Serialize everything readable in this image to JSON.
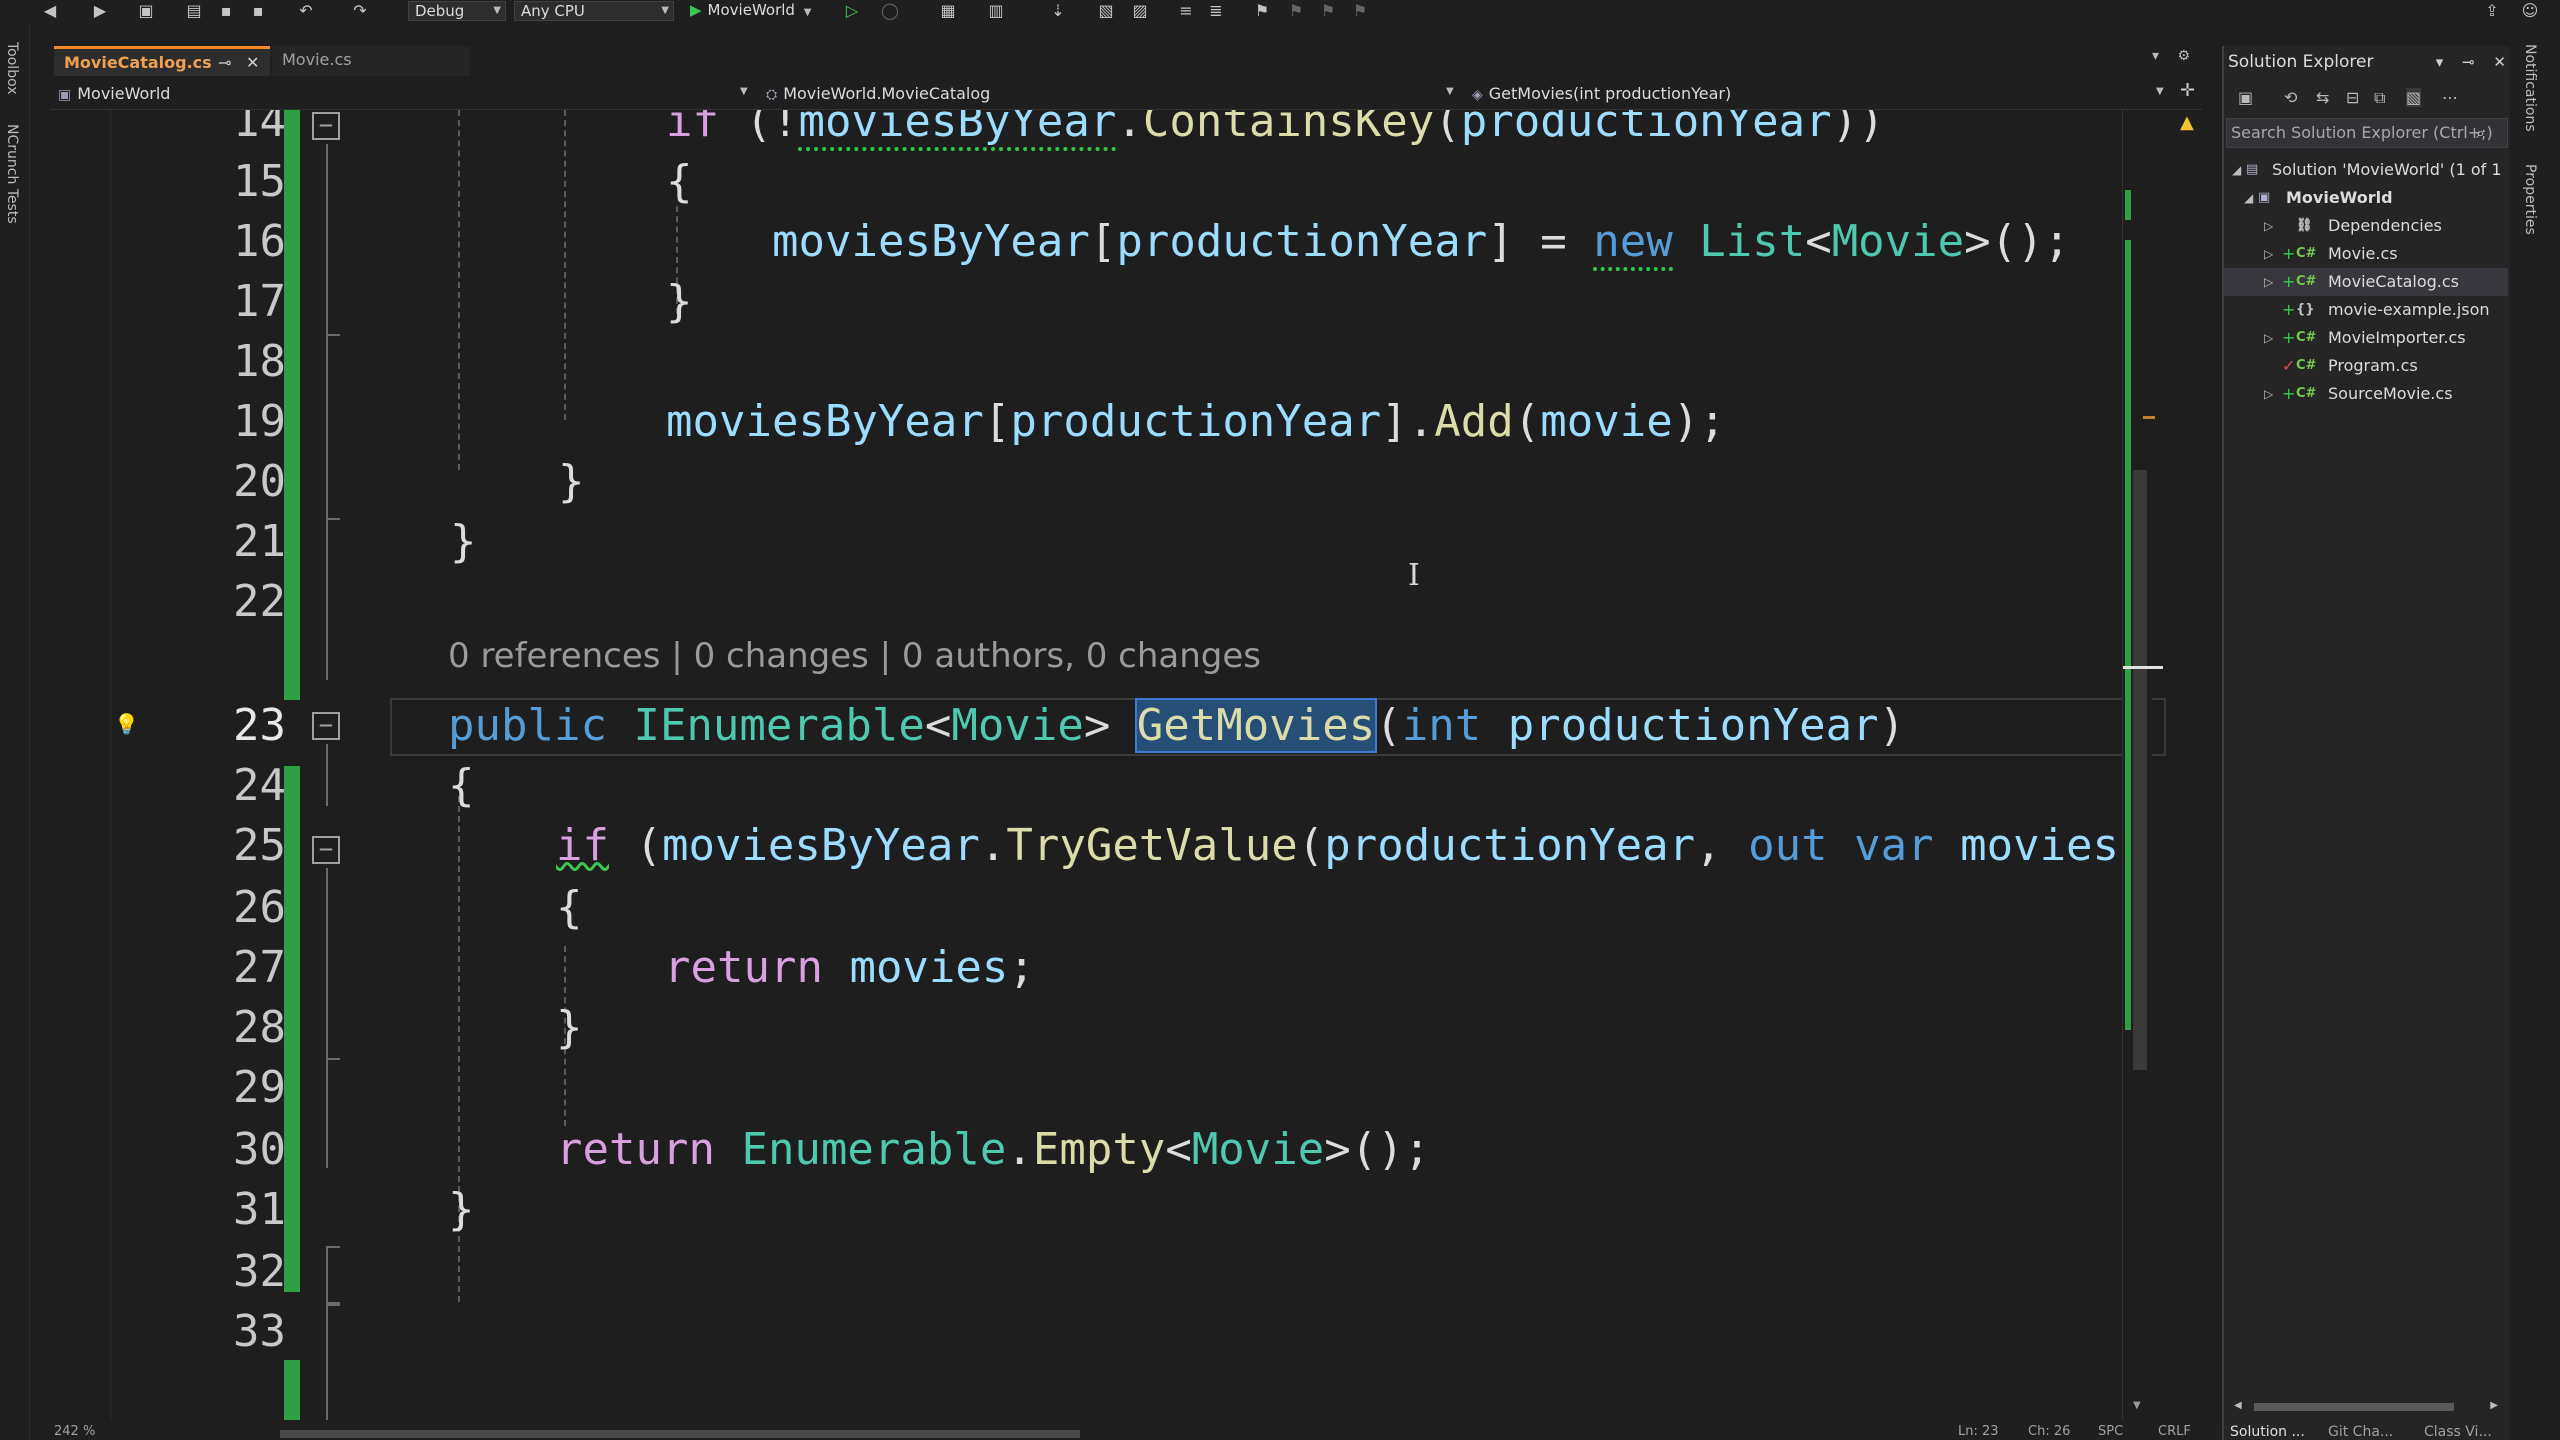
{
  "toolbar": {
    "config": "Debug",
    "platform": "Any CPU",
    "run_target": "MovieWorld"
  },
  "left_rail": {
    "toolbox": "Toolbox",
    "ncrunch": "NCrunch Tests"
  },
  "tabs": [
    {
      "label": "MovieCatalog.cs",
      "active": true
    },
    {
      "label": "Movie.cs",
      "active": false
    }
  ],
  "navbar": {
    "project": "MovieWorld",
    "class": "MovieWorld.MovieCatalog",
    "member": "GetMovies(int productionYear)"
  },
  "editor": {
    "line_numbers": [
      "14",
      "15",
      "16",
      "17",
      "18",
      "19",
      "20",
      "21",
      "22",
      "23",
      "24",
      "25",
      "26",
      "27",
      "28",
      "29",
      "30",
      "31",
      "32",
      "33"
    ],
    "codelens": "0 references | 0 changes | 0 authors, 0 changes",
    "code": {
      "l14": [
        "if",
        " (!",
        "moviesByYear",
        ".",
        "ContainsKey",
        "(",
        "productionYear",
        "))"
      ],
      "l15": "{",
      "l16": [
        "moviesByYear",
        "[",
        "productionYear",
        "] = ",
        "new",
        " ",
        "List",
        "<",
        "Movie",
        ">();"
      ],
      "l17": "}",
      "l19": [
        "moviesByYear",
        "[",
        "productionYear",
        "].",
        "Add",
        "(",
        "movie",
        ");"
      ],
      "l20": "}",
      "l21": "}",
      "l23": [
        "public",
        " ",
        "IEnumerable",
        "<",
        "Movie",
        "> ",
        "GetMovies",
        "(",
        "int",
        " ",
        "productionYear",
        ")"
      ],
      "l24": "{",
      "l25": [
        "if",
        " (",
        "moviesByYear",
        ".",
        "TryGetValue",
        "(",
        "productionYear",
        ", ",
        "out",
        " ",
        "var",
        " ",
        "movies"
      ],
      "l26": "{",
      "l27": [
        "return",
        " ",
        "movies",
        ";"
      ],
      "l28": "}",
      "l30": [
        "return",
        " ",
        "Enumerable",
        ".",
        "Empty",
        "<",
        "Movie",
        ">();"
      ],
      "l31": "}"
    }
  },
  "status": {
    "zoom": "242 %",
    "line": "Ln: 23",
    "col": "Ch: 26",
    "spc": "SPC",
    "crlf": "CRLF"
  },
  "solution_explorer": {
    "title": "Solution Explorer",
    "search_placeholder": "Search Solution Explorer (Ctrl+;)",
    "solution": "Solution 'MovieWorld' (1 of 1",
    "project": "MovieWorld",
    "items": [
      {
        "label": "Dependencies",
        "icon": "dependencies-icon"
      },
      {
        "label": "Movie.cs",
        "icon": "csharp-file-icon"
      },
      {
        "label": "MovieCatalog.cs",
        "icon": "csharp-file-icon",
        "selected": true
      },
      {
        "label": "movie-example.json",
        "icon": "json-file-icon"
      },
      {
        "label": "MovieImporter.cs",
        "icon": "csharp-file-icon"
      },
      {
        "label": "Program.cs",
        "icon": "csharp-file-icon"
      },
      {
        "label": "SourceMovie.cs",
        "icon": "csharp-file-icon"
      }
    ],
    "bottom_tabs": [
      "Solution ...",
      "Git Cha...",
      "Class Vi..."
    ]
  },
  "right_rail": {
    "notifications": "Notifications",
    "properties": "Properties"
  }
}
